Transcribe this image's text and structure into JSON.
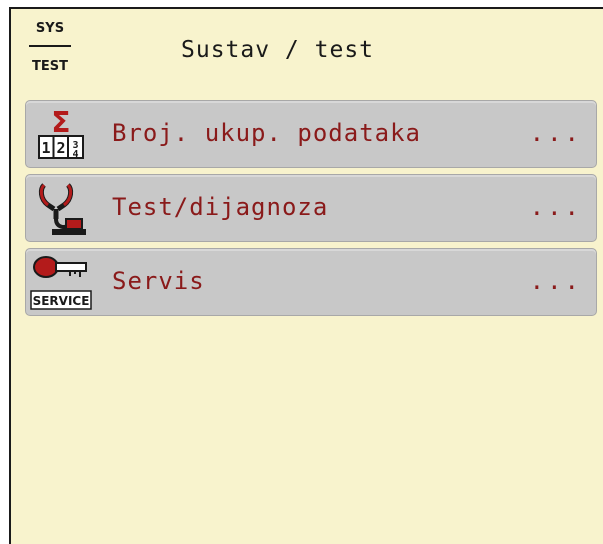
{
  "header": {
    "badge_top": "SYS",
    "badge_bottom": "TEST",
    "title": "Sustav / test"
  },
  "menu": {
    "items": [
      {
        "label": "Broj. ukup. podataka",
        "suffix": "...",
        "icon": "sigma-counter-icon"
      },
      {
        "label": "Test/dijagnoza",
        "suffix": "...",
        "icon": "stethoscope-icon"
      },
      {
        "label": "Servis",
        "suffix": "...",
        "icon": "service-key-icon",
        "icon_text": "SERVICE"
      }
    ]
  },
  "colors": {
    "background": "#f8f3cd",
    "item_background": "#c8c8c8",
    "label_text": "#8a1a1a",
    "icon_red": "#b31b1b"
  }
}
